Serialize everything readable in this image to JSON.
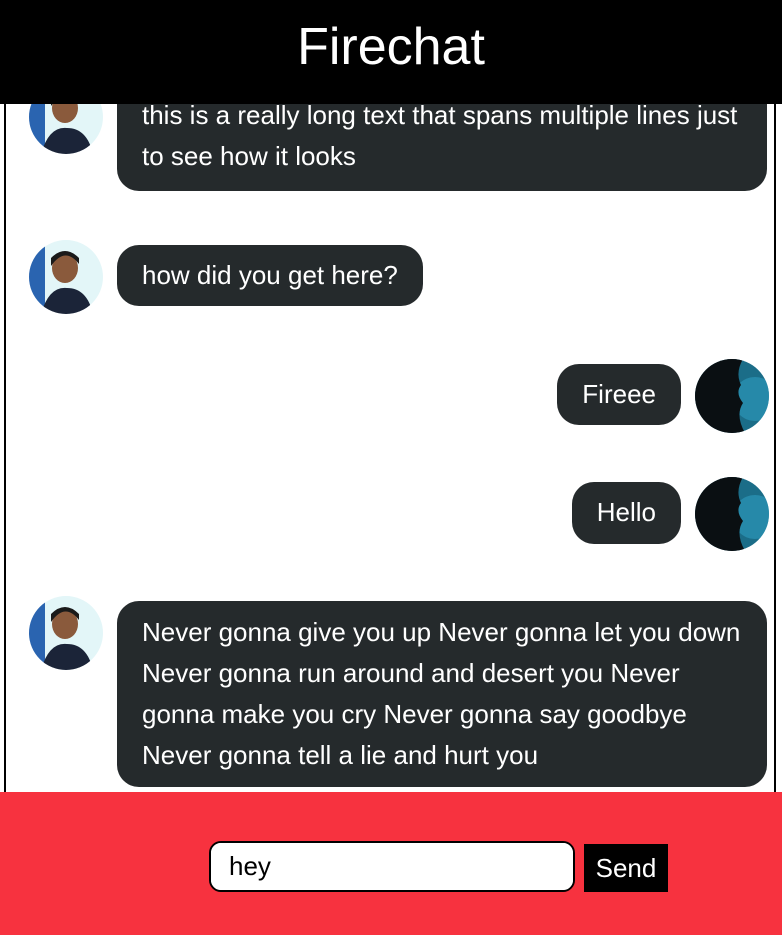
{
  "header": {
    "title": "Firechat"
  },
  "messages": [
    {
      "side": "left",
      "avatar": "user-photo-avatar",
      "text": "this is a really long text that spans multiple lines just to see how it looks"
    },
    {
      "side": "left",
      "avatar": "user-photo-avatar",
      "text": "how did you get here?"
    },
    {
      "side": "right",
      "avatar": "silhouette-avatar",
      "text": "Fireee"
    },
    {
      "side": "right",
      "avatar": "silhouette-avatar",
      "text": "Hello"
    },
    {
      "side": "left",
      "avatar": "user-photo-avatar",
      "text": "Never gonna give you up Never gonna let you down Never gonna run around and desert you Never gonna make you cry Never gonna say goodbye Never gonna tell a lie and hurt you"
    }
  ],
  "composer": {
    "input_value": "hey",
    "send_label": "Send"
  },
  "colors": {
    "header_bg": "#000000",
    "bubble_bg": "#252a2c",
    "footer_bg": "#f7323f"
  }
}
